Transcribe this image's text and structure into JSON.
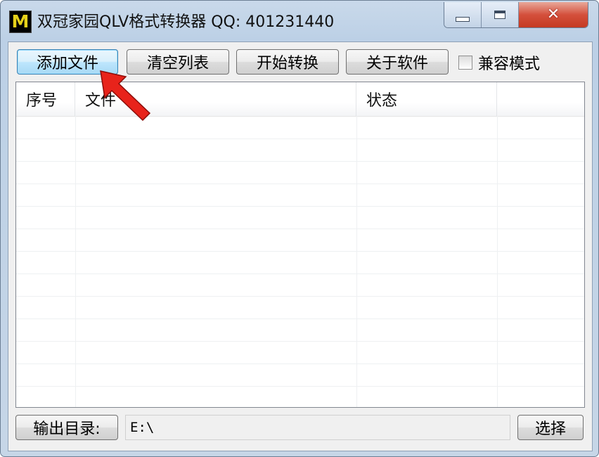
{
  "window": {
    "icon_letter": "M",
    "title": "双冠家园QLV格式转换器 QQ: 401231440",
    "controls": {
      "close_glyph": "✕"
    }
  },
  "toolbar": {
    "add_files": "添加文件",
    "clear_list": "清空列表",
    "start_convert": "开始转换",
    "about": "关于软件",
    "compat_mode": {
      "label": "兼容模式",
      "checked": false
    }
  },
  "table": {
    "columns": [
      "序号",
      "文件",
      "状态",
      ""
    ],
    "rows": []
  },
  "output": {
    "button_label": "输出目录:",
    "path": "E:\\",
    "select_label": "选择"
  },
  "annotation": {
    "arrow_color": "#e8231b"
  },
  "colors": {
    "focused_button_border": "#3c7fb1",
    "close_button": "#c53a22"
  }
}
